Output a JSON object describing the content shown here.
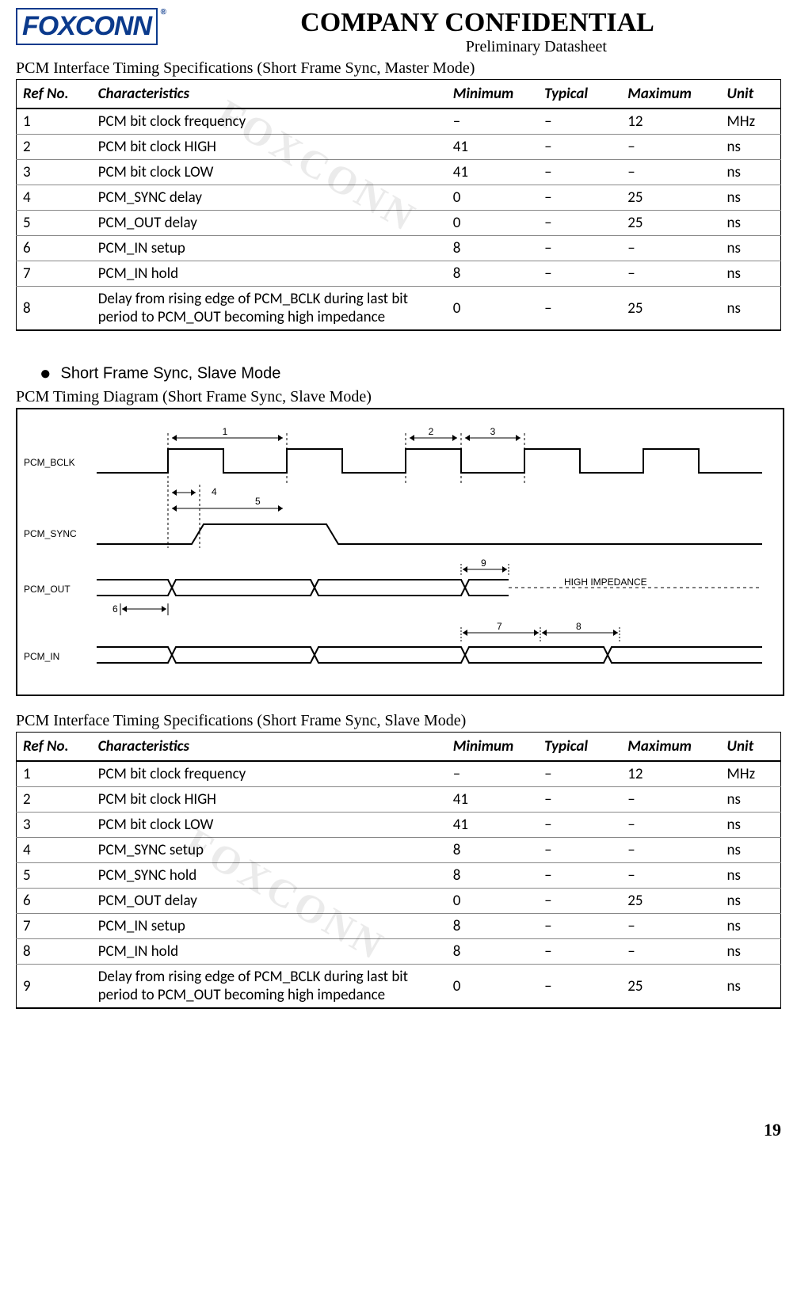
{
  "logo_text": "FOXCONN",
  "logo_reg": "®",
  "main_title": "COMPANY  CONFIDENTIAL",
  "subtitle": "Preliminary  Datasheet",
  "table1_caption": "PCM Interface Timing Specifications (Short Frame Sync, Master Mode)",
  "headers": {
    "ref": "Ref No.",
    "char": "Characteristics",
    "min": "Minimum",
    "typ": "Typical",
    "max": "Maximum",
    "unit": "Unit"
  },
  "table1_rows": [
    {
      "ref": "1",
      "char": "PCM bit clock frequency",
      "min": "–",
      "typ": "–",
      "max": "12",
      "unit": "MHz"
    },
    {
      "ref": "2",
      "char": "PCM bit clock HIGH",
      "min": "41",
      "typ": "–",
      "max": "–",
      "unit": "ns"
    },
    {
      "ref": "3",
      "char": "PCM bit clock LOW",
      "min": "41",
      "typ": "–",
      "max": "–",
      "unit": "ns"
    },
    {
      "ref": "4",
      "char": "PCM_SYNC delay",
      "min": "0",
      "typ": "–",
      "max": "25",
      "unit": "ns"
    },
    {
      "ref": "5",
      "char": "PCM_OUT delay",
      "min": "0",
      "typ": "–",
      "max": "25",
      "unit": "ns"
    },
    {
      "ref": "6",
      "char": "PCM_IN setup",
      "min": "8",
      "typ": "–",
      "max": "–",
      "unit": "ns"
    },
    {
      "ref": "7",
      "char": "PCM_IN hold",
      "min": "8",
      "typ": "–",
      "max": "–",
      "unit": "ns"
    },
    {
      "ref": "8",
      "char": "Delay from rising edge of PCM_BCLK during last bit period to PCM_OUT becoming high impedance",
      "min": "0",
      "typ": "–",
      "max": "25",
      "unit": "ns"
    }
  ],
  "bullet_text": "Short Frame Sync, Slave Mode",
  "diagram_caption": "PCM Timing Diagram (Short Frame Sync, Slave Mode)",
  "diagram": {
    "signals": [
      "PCM_BCLK",
      "PCM_SYNC",
      "PCM_OUT",
      "PCM_IN"
    ],
    "markers": [
      "1",
      "2",
      "3",
      "4",
      "5",
      "6",
      "7",
      "8",
      "9"
    ],
    "annotation": "HIGH IMPEDANCE"
  },
  "table2_caption": "PCM Interface Timing Specifications (Short Frame Sync, Slave Mode)",
  "table2_rows": [
    {
      "ref": "1",
      "char": "PCM bit clock frequency",
      "min": "–",
      "typ": "–",
      "max": "12",
      "unit": "MHz"
    },
    {
      "ref": "2",
      "char": "PCM bit clock HIGH",
      "min": "41",
      "typ": "–",
      "max": "–",
      "unit": "ns"
    },
    {
      "ref": "3",
      "char": "PCM bit clock LOW",
      "min": "41",
      "typ": "–",
      "max": "–",
      "unit": "ns"
    },
    {
      "ref": "4",
      "char": "PCM_SYNC setup",
      "min": "8",
      "typ": "–",
      "max": "–",
      "unit": "ns"
    },
    {
      "ref": "5",
      "char": "PCM_SYNC hold",
      "min": "8",
      "typ": "–",
      "max": "–",
      "unit": "ns"
    },
    {
      "ref": "6",
      "char": "PCM_OUT delay",
      "min": "0",
      "typ": "–",
      "max": "25",
      "unit": "ns"
    },
    {
      "ref": "7",
      "char": "PCM_IN setup",
      "min": "8",
      "typ": "–",
      "max": "–",
      "unit": "ns"
    },
    {
      "ref": "8",
      "char": "PCM_IN hold",
      "min": "8",
      "typ": "–",
      "max": "–",
      "unit": "ns"
    },
    {
      "ref": "9",
      "char": "Delay from rising edge of PCM_BCLK during last bit period to PCM_OUT becoming high impedance",
      "min": "0",
      "typ": "–",
      "max": "25",
      "unit": "ns"
    }
  ],
  "page_number": "19",
  "watermark": "FOXCONN"
}
